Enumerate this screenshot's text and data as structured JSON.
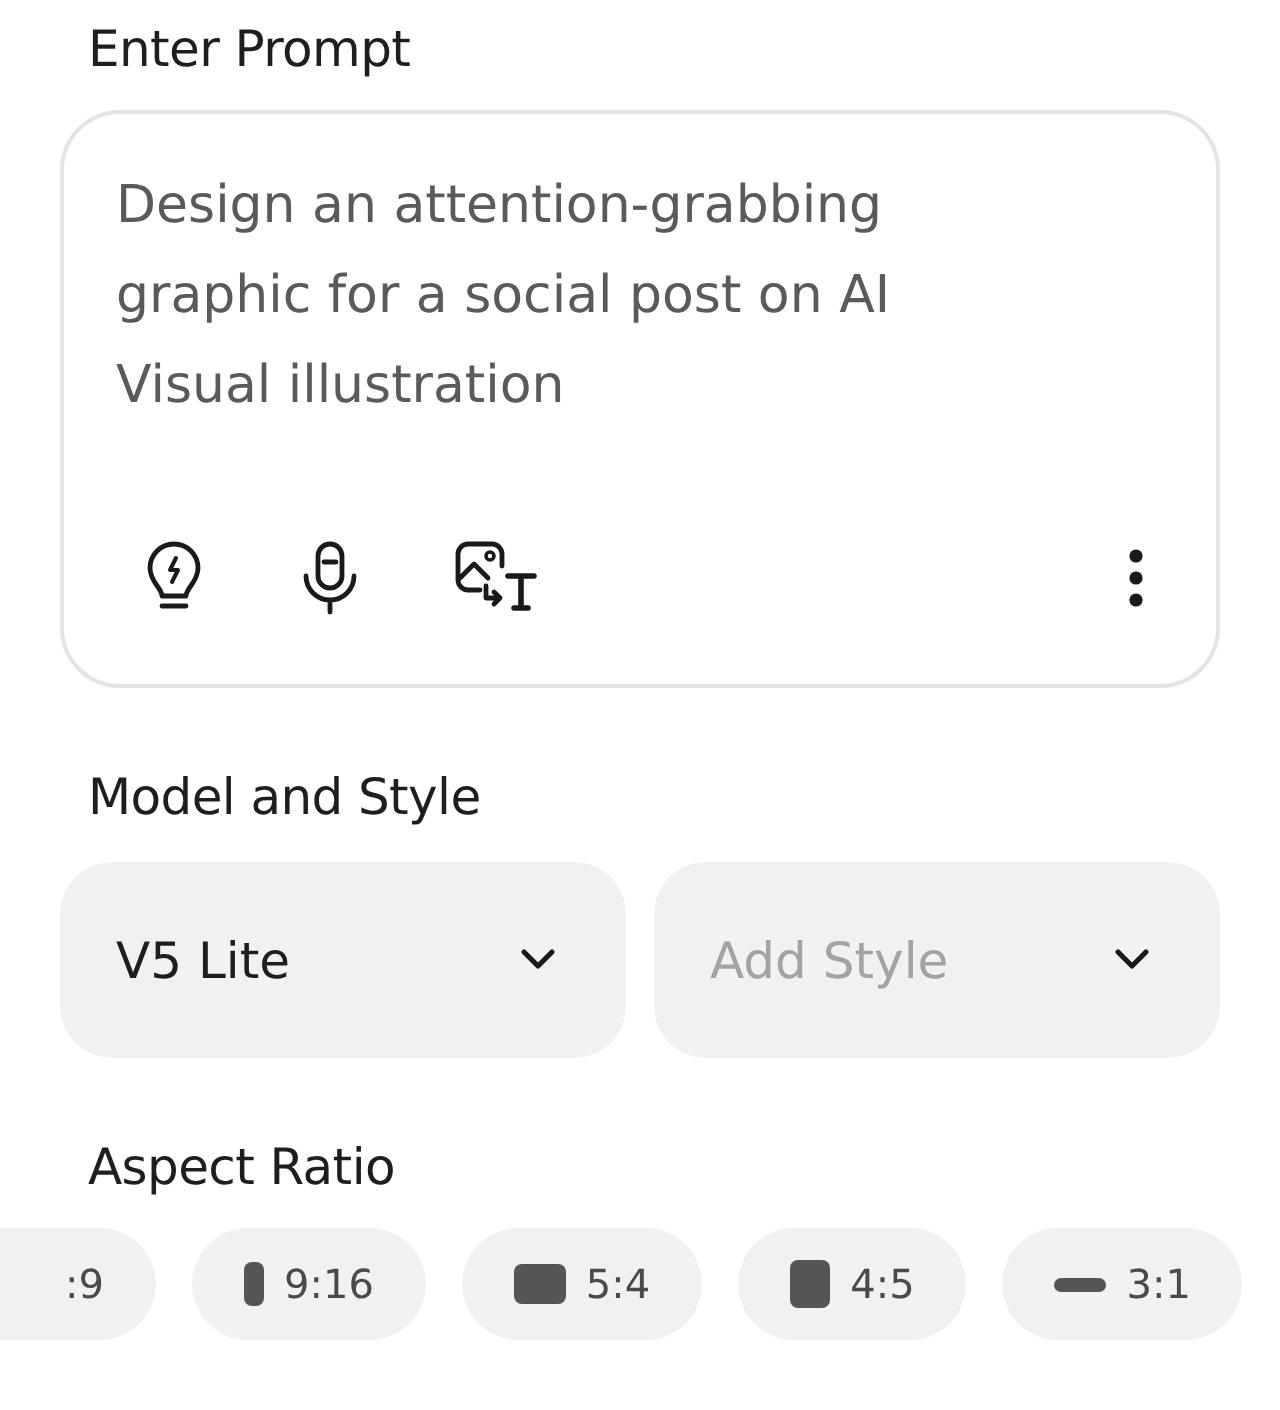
{
  "prompt_section": {
    "title": "Enter Prompt",
    "placeholder": "Design an attention-grabbing graphic for a social post on AI Visual illustration"
  },
  "model_section": {
    "title": "Model and Style",
    "dropdowns": [
      {
        "value": "V5 Lite",
        "kind": "value"
      },
      {
        "placeholder": "Add Style",
        "kind": "placeholder"
      }
    ]
  },
  "aspect_section": {
    "title": "Aspect Ratio",
    "options": [
      {
        "label": ":9",
        "kind": "none"
      },
      {
        "label": "9:16",
        "kind": "tall"
      },
      {
        "label": "5:4",
        "kind": "landscape"
      },
      {
        "label": "4:5",
        "kind": "portrait"
      },
      {
        "label": "3:1",
        "kind": "wide"
      }
    ]
  }
}
